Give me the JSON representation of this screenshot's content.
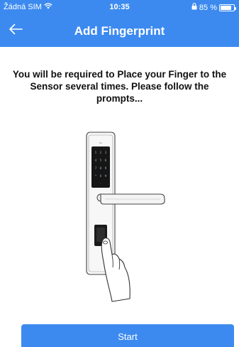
{
  "status_bar": {
    "carrier": "Žádná SIM",
    "time": "10:35",
    "battery_percent": "85 %",
    "battery_level": 0.85
  },
  "nav": {
    "title": "Add Fingerprint",
    "back_icon": "arrow-left-icon"
  },
  "instructions": "You will be required to Place your Finger to the Sensor several times. Please follow the prompts...",
  "start_button": {
    "label": "Start"
  },
  "colors": {
    "primary": "#3c8af0",
    "text": "#111111",
    "background": "#ffffff"
  }
}
